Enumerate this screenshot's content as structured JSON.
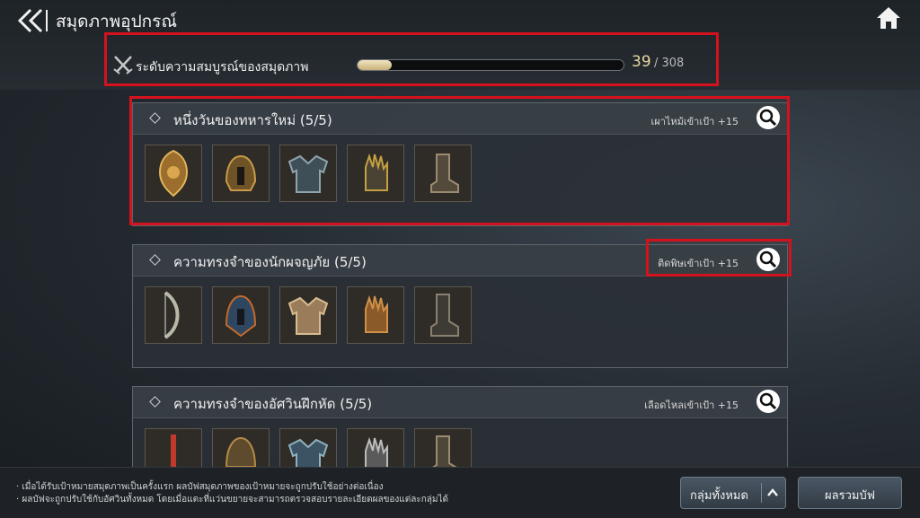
{
  "header": {
    "title": "สมุดภาพอุปกรณ์"
  },
  "completion": {
    "label": "ระดับความสมบูรณ์ของสมุดภาพ",
    "current": "39",
    "total": "/ 308",
    "progress_fraction": 0.127
  },
  "cards": [
    {
      "title": "หนึ่งวันของทหารใหม่ (5/5)",
      "bonus": "เผาไหม้เข้าเป้า +15",
      "items": [
        "shield-item",
        "helmet-item",
        "armor-item",
        "gloves-item",
        "boots-item"
      ]
    },
    {
      "title": "ความทรงจำของนักผจญภัย (5/5)",
      "bonus": "ติดพิษเข้าเป้า +15",
      "items": [
        "bow-item",
        "helmet-item",
        "armor-item",
        "gloves-item",
        "boots-item"
      ]
    },
    {
      "title": "ความทรงจำของอัศวินฝึกหัด (5/5)",
      "bonus": "เลือดไหลเข้าเป้า +15",
      "items": [
        "sword-item",
        "helmet-item",
        "armor-item",
        "gloves-item",
        "boots-item"
      ]
    }
  ],
  "footer": {
    "notes": [
      "· เมื่อได้รับเป้าหมายสมุดภาพเป็นครั้งแรก ผลบัฟสมุดภาพของเป้าหมายจะถูกปรับใช้อย่างต่อเนื่อง",
      "· ผลบัฟจะถูกปรับใช้กับอัศวินทั้งหมด โดยเมื่อแตะที่แว่นขยายจะสามารถตรวจสอบรายละเอียดผลของแต่ละกลุ่มได้"
    ],
    "group_button": "กลุ่มทั้งหมด",
    "summary_button": "ผลรวมบัฟ"
  },
  "colors": {
    "highlight_red": "#d4121d",
    "progress_fill": "#e8dbb4",
    "count_gold": "#e8d7a0"
  }
}
